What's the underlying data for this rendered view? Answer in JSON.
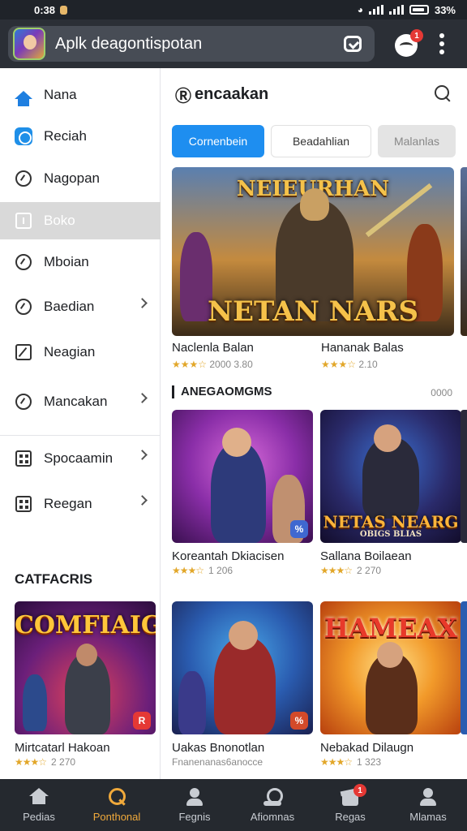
{
  "status_bar": {
    "time": "0:38",
    "battery": "33%"
  },
  "header": {
    "title": "Aplk deagontispotan",
    "notification_count": "1"
  },
  "sidebar": {
    "items": [
      {
        "label": "Nana"
      },
      {
        "label": "Reciah"
      },
      {
        "label": "Nagopan"
      },
      {
        "label": "Boko"
      },
      {
        "label": "Mboian"
      },
      {
        "label": "Baedian"
      },
      {
        "label": "Neagian"
      },
      {
        "label": "Mancakan"
      },
      {
        "label": "Spocaamin"
      },
      {
        "label": "Reegan"
      }
    ],
    "section_title": "CATFACRIS",
    "card": {
      "name": "Mirtcatarl Hakoan",
      "rating": "2 270",
      "logo": "COMFIAIG"
    }
  },
  "main": {
    "title": "encaakan",
    "tabs": [
      "Cornenbein",
      "Beadahlian",
      "Malanlas"
    ],
    "featured": {
      "logo_top": "NEIEURHAN",
      "logo_bottom": "NETAN NARS",
      "left_label": "Naclenla Balan",
      "left_rating": "2000 3.80",
      "right_label": "Hananak Balas",
      "right_rating": "2.10"
    },
    "section": {
      "title": "ANEGAOMGMS",
      "more": "0000"
    },
    "cards": [
      {
        "name": "Koreantah Dkiacisen",
        "rating": "1 206",
        "badge": "%"
      },
      {
        "name": "Sallana Boilaean",
        "rating": "2 270",
        "logo": "NETAS NEARG",
        "logo_sub": "OBIGS BLIAS"
      },
      {
        "name": "Uakas Bnonotlan",
        "rating": "Fnanenanas6anocce",
        "badge": "%"
      },
      {
        "name": "Nebakad Dilaugn",
        "rating": "1 323",
        "logo": "HAMEAX"
      }
    ]
  },
  "bottom_nav": [
    {
      "label": "Pedias"
    },
    {
      "label": "Ponthonal"
    },
    {
      "label": "Fegnis"
    },
    {
      "label": "Afiomnas"
    },
    {
      "label": "Regas",
      "badge": "1"
    },
    {
      "label": "Mlamas"
    }
  ]
}
